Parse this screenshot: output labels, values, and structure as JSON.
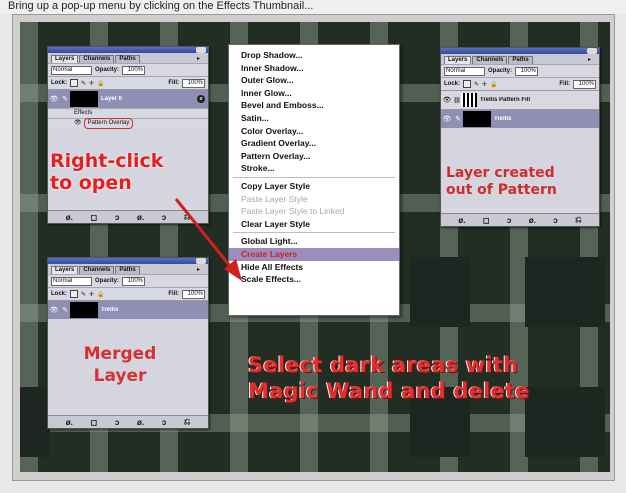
{
  "top_caption": "Bring up a pop-up menu by clicking on the Effects Thumbnail...",
  "panel_common": {
    "tabs": [
      "Layers",
      "Channels",
      "Paths"
    ],
    "blend_mode": "Normal",
    "opacity_label": "Opacity:",
    "opacity_value": "100%",
    "lock_label": "Lock:",
    "fill_label": "Fill:",
    "fill_value": "100%"
  },
  "panel_top_left": {
    "layer_name": "Layer 0",
    "effects_label": "Effects",
    "effect_item": "Pattern Overlay",
    "bottom_icons": [
      "ø.",
      "◻",
      "ɔ",
      "ø.",
      "ɔ",
      "⎌"
    ]
  },
  "panel_top_right": {
    "layer1_name": "Trellis Pattern Fill",
    "layer2_name": "Trellis",
    "bottom_icons": [
      "ø.",
      "◻",
      "ɔ",
      "ø.",
      "ɔ",
      "⎌"
    ]
  },
  "panel_bottom_left": {
    "layer_name": "Trellis",
    "bottom_icons": [
      "ø.",
      "◻",
      "ɔ",
      "ø.",
      "ɔ",
      "⎌"
    ]
  },
  "context_menu": {
    "group1": [
      "Drop Shadow...",
      "Inner Shadow...",
      "Outer Glow...",
      "Inner Glow...",
      "Bevel and Emboss...",
      "Satin...",
      "Color Overlay...",
      "Gradient Overlay...",
      "Pattern Overlay...",
      "Stroke..."
    ],
    "copy_style": "Copy Layer Style",
    "paste_style": "Paste Layer Style",
    "paste_linked": "Paste Layer Style to Linked",
    "clear_style": "Clear Layer Style",
    "global_light": "Global Light...",
    "create_layers": "Create Layers",
    "hide_effects": "Hide All Effects",
    "scale_effects": "Scale Effects..."
  },
  "annotations": {
    "right_click_line1": "Right-click",
    "right_click_line2": "to open",
    "layer_created_line1": "Layer created",
    "layer_created_line2": "out of Pattern",
    "merged_line1": "Merged",
    "merged_line2": "Layer",
    "select_line1": "Select dark areas with",
    "select_line2": "Magic Wand and delete"
  },
  "colors": {
    "annotation_red": "#e22020",
    "menu_highlight": "#9b8ebf",
    "panel_bg": "#d8d8e2"
  }
}
